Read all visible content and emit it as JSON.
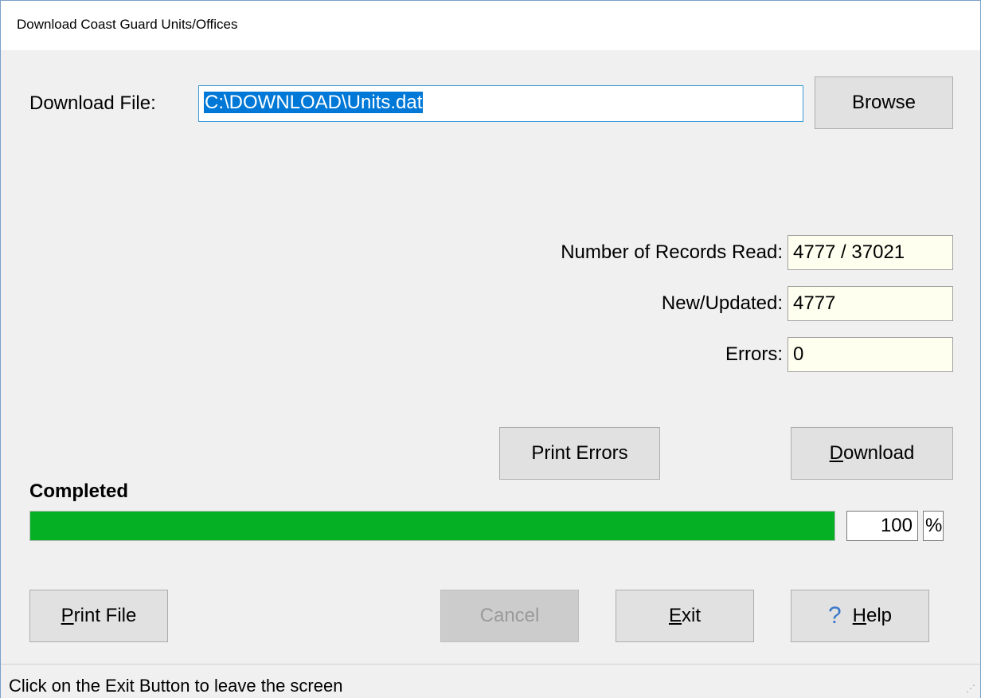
{
  "window": {
    "title": "Download Coast Guard Units/Offices"
  },
  "download_file": {
    "label": "Download File:",
    "value": "C:\\DOWNLOAD\\Units.dat"
  },
  "buttons": {
    "browse": "Browse",
    "print_errors": "Print Errors",
    "download_prefix": "D",
    "download_rest": "ownload",
    "print_file_prefix": "P",
    "print_file_rest": "rint File",
    "cancel": "Cancel",
    "exit_prefix": "E",
    "exit_rest": "xit",
    "help_prefix": "H",
    "help_rest": "elp"
  },
  "stats": {
    "records_read_label": "Number of Records Read:",
    "records_read_value": "4777 / 37021",
    "new_updated_label": "New/Updated:",
    "new_updated_value": "4777",
    "errors_label": "Errors:",
    "errors_value": "0"
  },
  "progress": {
    "label": "Completed",
    "value": "100",
    "unit": "%",
    "fraction": 1.0,
    "color": "#06b025"
  },
  "icons": {
    "help": "question-mark-icon",
    "grip": "resize-grip-icon"
  },
  "status_bar": {
    "text": "Click on the Exit Button to leave the screen"
  }
}
